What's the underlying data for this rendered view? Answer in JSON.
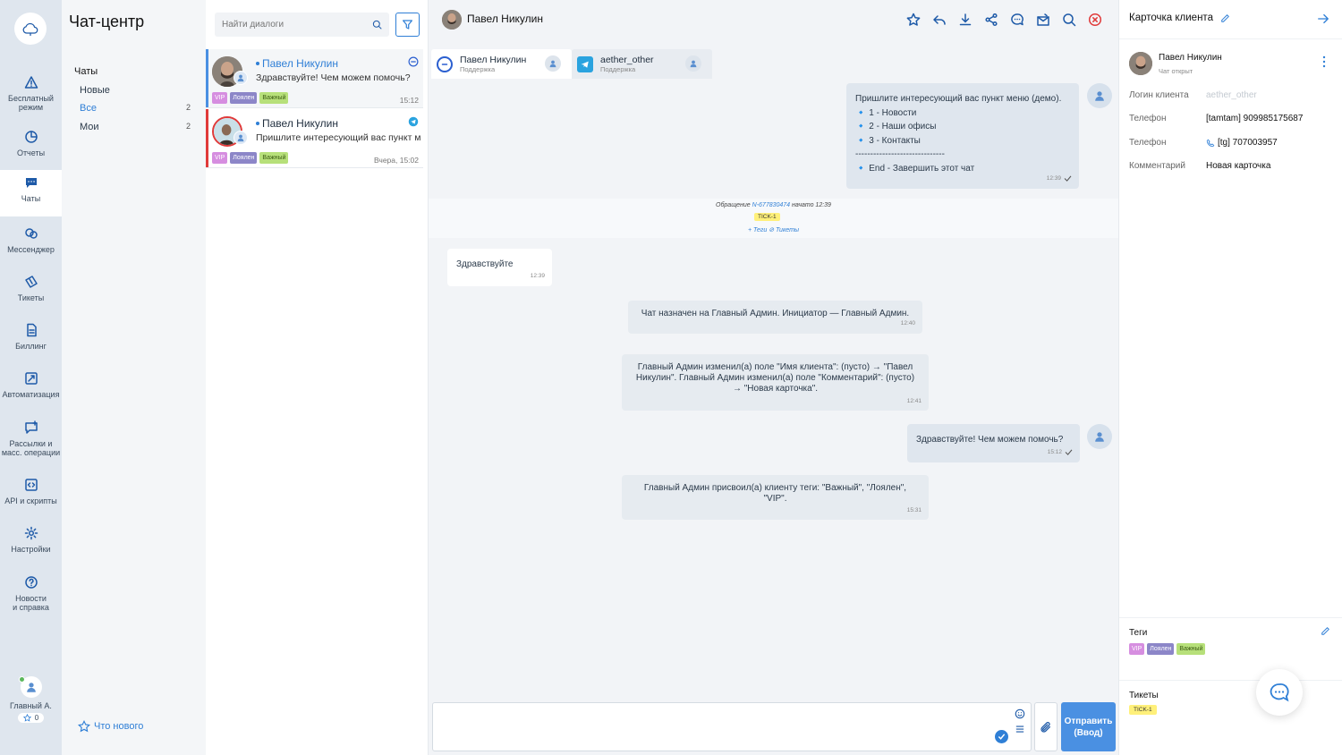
{
  "rail": {
    "items": [
      {
        "label": "Бесплатный\nрежим",
        "icon": "warning-icon"
      },
      {
        "label": "Отчеты",
        "icon": "pie-chart-icon"
      },
      {
        "label": "Чаты",
        "icon": "chat-icon"
      },
      {
        "label": "Мессенджер",
        "icon": "messenger-icon"
      },
      {
        "label": "Тикеты",
        "icon": "ticket-icon"
      },
      {
        "label": "Биллинг",
        "icon": "billing-icon"
      },
      {
        "label": "Автоматизация",
        "icon": "automation-icon"
      },
      {
        "label": "Рассылки и\nмасс. операции",
        "icon": "broadcast-icon"
      },
      {
        "label": "API и скрипты",
        "icon": "code-icon"
      },
      {
        "label": "Настройки",
        "icon": "gear-icon"
      },
      {
        "label": "Новости\nи справка",
        "icon": "help-icon"
      }
    ],
    "user_name": "Главный А.",
    "user_stars": "0"
  },
  "nav": {
    "title": "Чат-центр",
    "section": "Чаты",
    "items": [
      {
        "label": "Новые",
        "count": ""
      },
      {
        "label": "Все",
        "count": "2"
      },
      {
        "label": "Мои",
        "count": "2"
      }
    ],
    "whats_new": "Что нового"
  },
  "dialogs": {
    "search_placeholder": "Найти диалоги",
    "items": [
      {
        "name": "Павел Никулин",
        "message": "Здравствуйте! Чем можем помочь?",
        "time": "15:12",
        "channel": "tamtam"
      },
      {
        "name": "Павел Никулин",
        "message": "Пришлите интересующий вас пункт меню (демо).",
        "time": "Вчера, 15:02",
        "channel": "telegram"
      }
    ],
    "tags": [
      "VIP",
      "Лоялен",
      "Важный"
    ]
  },
  "chat": {
    "title": "Павел Никулин",
    "tabs": [
      {
        "name": "Павел Никулин",
        "sub": "Поддержка"
      },
      {
        "name": "aether_other",
        "sub": "Поддержка"
      }
    ],
    "menu_message": "Пришлите интересующий вас пункт меню (демо).\n🔹 1 - Новости\n🔹 2 - Наши офисы\n🔹 3 - Контакты\n------------------------------\n🔹 End - Завершить этот чат",
    "menu_time": "12:39",
    "ticket_line_prefix": "Обращение",
    "ticket_id": "N-677830474",
    "ticket_line_suffix": "начато 12:39",
    "ticket_tag": "TICK-1",
    "ticket_links": "+ Теги   ⊘ Тикеты",
    "hello_message": "Здравствуйте",
    "hello_time": "12:39",
    "sys1": "Чат назначен на Главный Админ. Инициатор — Главный Админ.",
    "sys1_time": "12:40",
    "sys2": "Главный Админ изменил(а) поле \"Имя клиента\": (пусто) → \"Павел Никулин\". Главный Админ изменил(а) поле \"Комментарий\": (пусто) → \"Новая карточка\".",
    "sys2_time": "12:41",
    "reply_message": "Здравствуйте! Чем можем помочь?",
    "reply_time": "15:12",
    "sys3": "Главный Админ присвоил(а) клиенту теги: \"Важный\", \"Лоялен\", \"VIP\".",
    "sys3_time": "15:31",
    "send_label": "Отправить\n(Ввод)"
  },
  "card": {
    "title": "Карточка клиента",
    "client_name": "Павел Никулин",
    "client_status": "Чат открыт",
    "fields": [
      {
        "key": "Логин клиента",
        "value": "aether_other"
      },
      {
        "key": "Телефон",
        "value": "[tamtam] 909985175687"
      },
      {
        "key": "Телефон",
        "value": "[tg] 707003957"
      },
      {
        "key": "Комментарий",
        "value": "Новая карточка"
      }
    ],
    "tags_title": "Теги",
    "tickets_title": "Тикеты",
    "ticket": "TICK-1"
  },
  "colors": {
    "accent": "#2f7fd6",
    "rail_bg": "#dfe6ee",
    "send_bg": "#4a90e2",
    "vip": "#d68ee0",
    "loyal": "#8c86c8",
    "important": "#b7e07a",
    "ticket": "#fff07a"
  }
}
